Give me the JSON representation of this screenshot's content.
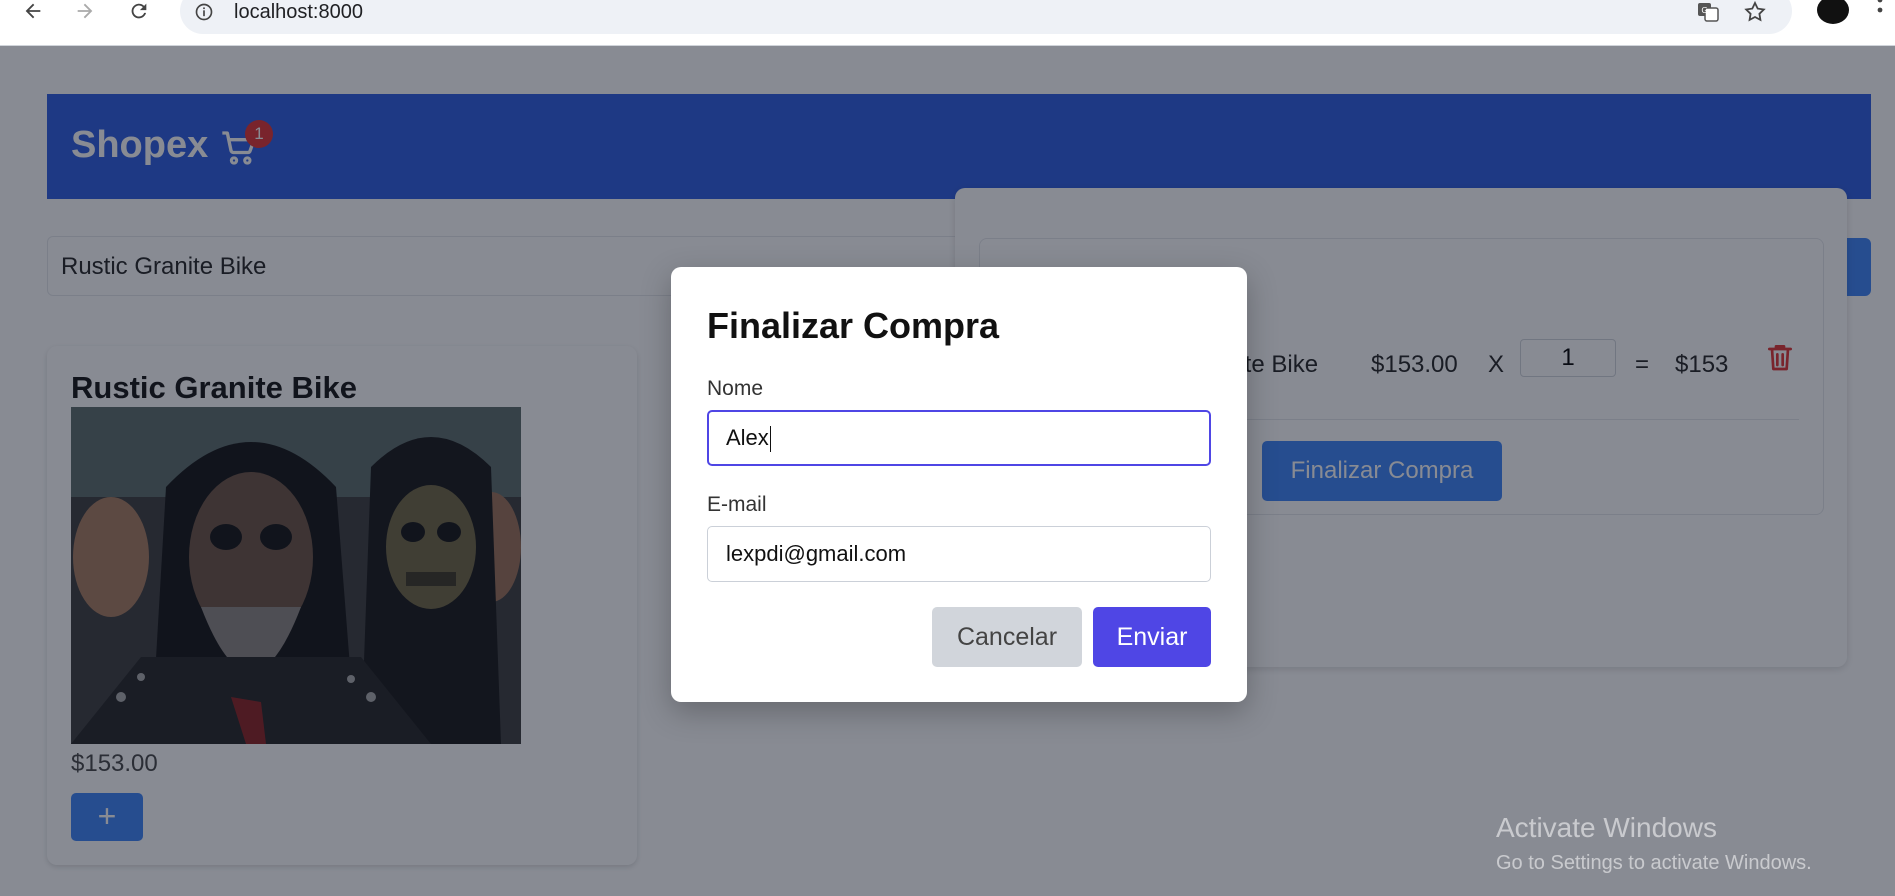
{
  "browser": {
    "url": "localhost:8000",
    "icons": [
      "back-icon",
      "forward-icon",
      "reload-icon",
      "info-icon",
      "translate-icon",
      "star-icon",
      "profile-avatar",
      "menu-icon"
    ]
  },
  "header": {
    "brand": "Shopex",
    "cart_count": "1",
    "brand_color": "#2b5be0"
  },
  "search": {
    "value": "Rustic Granite Bike"
  },
  "product": {
    "title": "Rustic Granite Bike",
    "price": "$153.00",
    "add_label": "+"
  },
  "cart": {
    "item_name_visible": "nite Bike",
    "unit_price": "$153.00",
    "times": "X",
    "quantity": "1",
    "equals": "=",
    "total": "$153",
    "finalize_label": "Finalizar Compra"
  },
  "modal": {
    "title": "Finalizar Compra",
    "name_label": "Nome",
    "name_value": "Alex",
    "email_label": "E-mail",
    "email_value": "lexpdi@gmail.com",
    "cancel_label": "Cancelar",
    "send_label": "Enviar",
    "accent": "#4f46e5"
  },
  "watermark": {
    "line1": "Activate Windows",
    "line2": "Go to Settings to activate Windows."
  }
}
